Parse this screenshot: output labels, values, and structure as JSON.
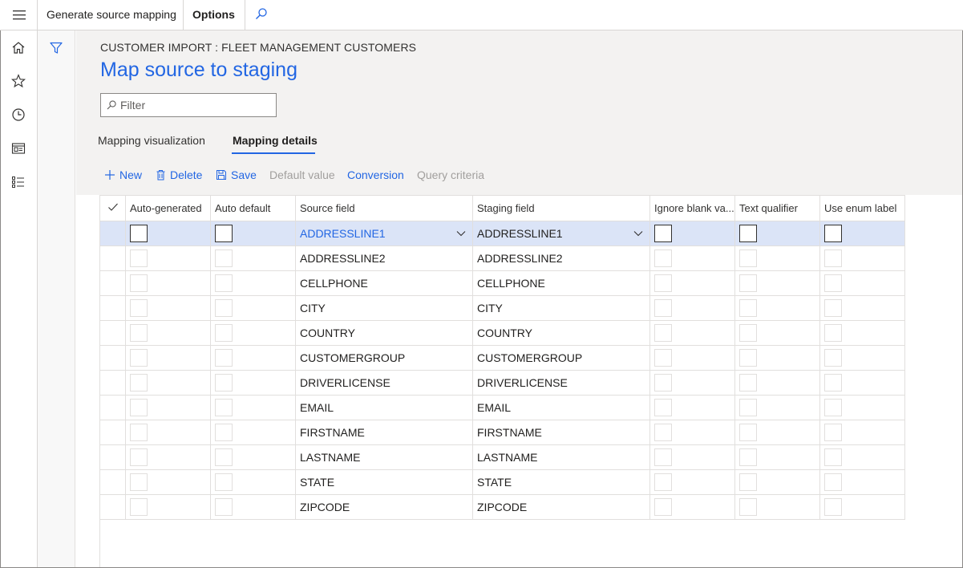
{
  "topbar": {
    "generate_label": "Generate source mapping",
    "options_label": "Options"
  },
  "page": {
    "caption": "CUSTOMER IMPORT : FLEET MANAGEMENT CUSTOMERS",
    "title": "Map source to staging",
    "filter_placeholder": "Filter"
  },
  "tabs": [
    {
      "label": "Mapping visualization",
      "active": false
    },
    {
      "label": "Mapping details",
      "active": true
    }
  ],
  "actions": {
    "new": "New",
    "delete": "Delete",
    "save": "Save",
    "default_value": "Default value",
    "conversion": "Conversion",
    "query_criteria": "Query criteria"
  },
  "grid": {
    "columns": [
      "Auto-generated",
      "Auto default",
      "Source field",
      "Staging field",
      "Ignore blank va...",
      "Text qualifier",
      "Use enum label"
    ],
    "rows": [
      {
        "source": "ADDRESSLINE1",
        "staging": "ADDRESSLINE1"
      },
      {
        "source": "ADDRESSLINE2",
        "staging": "ADDRESSLINE2"
      },
      {
        "source": "CELLPHONE",
        "staging": "CELLPHONE"
      },
      {
        "source": "CITY",
        "staging": "CITY"
      },
      {
        "source": "COUNTRY",
        "staging": "COUNTRY"
      },
      {
        "source": "CUSTOMERGROUP",
        "staging": "CUSTOMERGROUP"
      },
      {
        "source": "DRIVERLICENSE",
        "staging": "DRIVERLICENSE"
      },
      {
        "source": "EMAIL",
        "staging": "EMAIL"
      },
      {
        "source": "FIRSTNAME",
        "staging": "FIRSTNAME"
      },
      {
        "source": "LASTNAME",
        "staging": "LASTNAME"
      },
      {
        "source": "STATE",
        "staging": "STATE"
      },
      {
        "source": "ZIPCODE",
        "staging": "ZIPCODE"
      }
    ]
  },
  "colors": {
    "accent": "#2266e3",
    "selected_row": "#dbe4f7",
    "header_band": "#f3f2f1"
  },
  "icons": {
    "menu": "hamburger-icon",
    "search": "search-icon",
    "home": "home-icon",
    "favorites": "star-icon",
    "recent": "clock-icon",
    "workspaces": "workspace-icon",
    "modules": "list-icon",
    "filter": "funnel-icon"
  }
}
